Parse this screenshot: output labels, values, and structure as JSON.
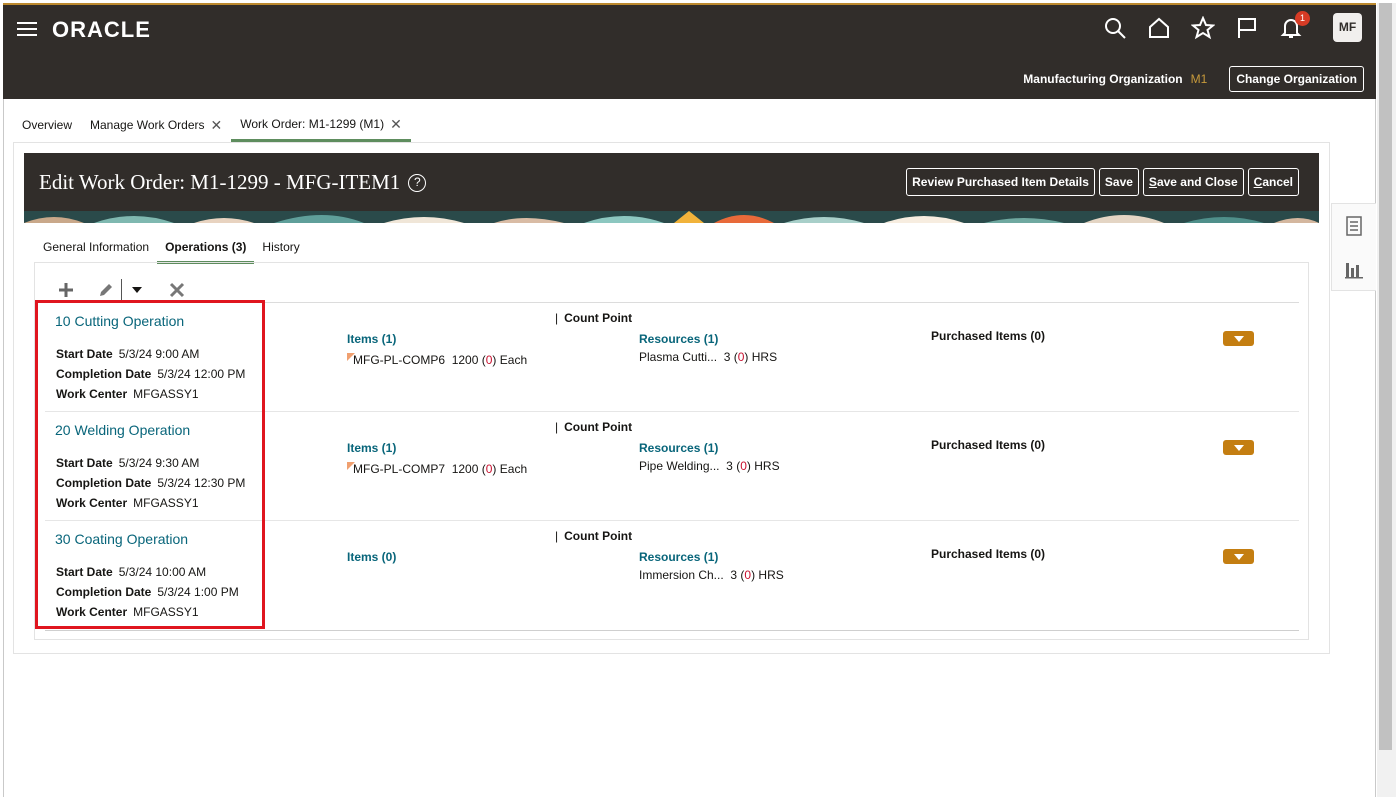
{
  "header": {
    "logo": "ORACLE",
    "notification_count": "1",
    "user_initials": "MF",
    "org_label": "Manufacturing Organization",
    "org_code": "M1",
    "change_org_label": "Change Organization"
  },
  "tabs": [
    {
      "label": "Overview"
    },
    {
      "label": "Manage Work Orders"
    },
    {
      "label": "Work Order: M1-1299 (M1)"
    }
  ],
  "page": {
    "title": "Edit Work Order: M1-1299 - MFG-ITEM1",
    "actions": {
      "review": "Review Purchased Item Details",
      "save": "Save",
      "save_close_underlined": "S",
      "save_close_rest": "ave and Close",
      "cancel_underlined": "C",
      "cancel_rest": "ancel"
    }
  },
  "subtabs": [
    {
      "label": "General Information"
    },
    {
      "label": "Operations (3)"
    },
    {
      "label": "History"
    }
  ],
  "field_labels": {
    "start": "Start Date",
    "completion": "Completion Date",
    "work_center": "Work Center",
    "count_point": "Count Point"
  },
  "operations": [
    {
      "title": "10 Cutting Operation",
      "start_date": "5/3/24 9:00 AM",
      "completion_date": "5/3/24 12:00 PM",
      "work_center": "MFGASSY1",
      "items_label": "Items (1)",
      "item_name": "MFG-PL-COMP6",
      "item_qty": "1200",
      "item_open": "0",
      "item_uom": "Each",
      "resources_label": "Resources (1)",
      "resource_name": "Plasma Cutti...",
      "resource_qty": "3",
      "resource_open": "0",
      "resource_uom": "HRS",
      "purchased_label": "Purchased Items (0)"
    },
    {
      "title": "20 Welding Operation",
      "start_date": "5/3/24 9:30 AM",
      "completion_date": "5/3/24 12:30 PM",
      "work_center": "MFGASSY1",
      "items_label": "Items (1)",
      "item_name": "MFG-PL-COMP7",
      "item_qty": "1200",
      "item_open": "0",
      "item_uom": "Each",
      "resources_label": "Resources (1)",
      "resource_name": "Pipe Welding...",
      "resource_qty": "3",
      "resource_open": "0",
      "resource_uom": "HRS",
      "purchased_label": "Purchased Items (0)"
    },
    {
      "title": "30 Coating Operation",
      "start_date": "5/3/24 10:00 AM",
      "completion_date": "5/3/24 1:00 PM",
      "work_center": "MFGASSY1",
      "items_label": "Items (0)",
      "resources_label": "Resources (1)",
      "resource_name": "Immersion Ch...",
      "resource_qty": "3",
      "resource_open": "0",
      "resource_uom": "HRS",
      "purchased_label": "Purchased Items (0)"
    }
  ],
  "colors": {
    "header_bg": "#312d2a",
    "link": "#08657a",
    "accent_tab": "#5e8d5e",
    "menu_button": "#c47e11",
    "highlight": "#e0151f"
  }
}
